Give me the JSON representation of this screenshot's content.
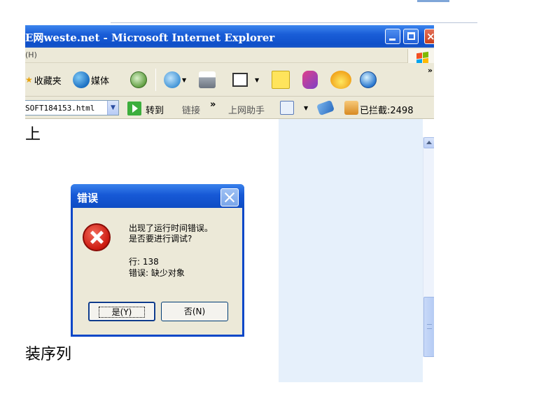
{
  "window": {
    "title": "E网weste.net - Microsoft Internet Explorer",
    "menu_fragment": "(H)"
  },
  "toolbar": {
    "favorites_label": "收藏夹",
    "media_label": "媒体",
    "more": "»"
  },
  "addressbar": {
    "url": "SOFT184153.html",
    "go_label": "转到",
    "links_label": "链接",
    "links_more": "»",
    "assistant_label": "上网助手",
    "blocked_label": "已拦截:2498"
  },
  "page": {
    "top_char": "上",
    "body_fragment": "装序列"
  },
  "dialog": {
    "title": "错误",
    "message_line1": "出现了运行时间错误。",
    "message_line2": "是否要进行调试?",
    "line_label": "行: 138",
    "error_label": "错误: 缺少对象",
    "yes_button": "是(Y)",
    "no_button": "否(N)"
  },
  "colors": {
    "xp_blue": "#0f4fc9",
    "error_red": "#cc1a10",
    "panel_blue": "#e6f0fb"
  }
}
